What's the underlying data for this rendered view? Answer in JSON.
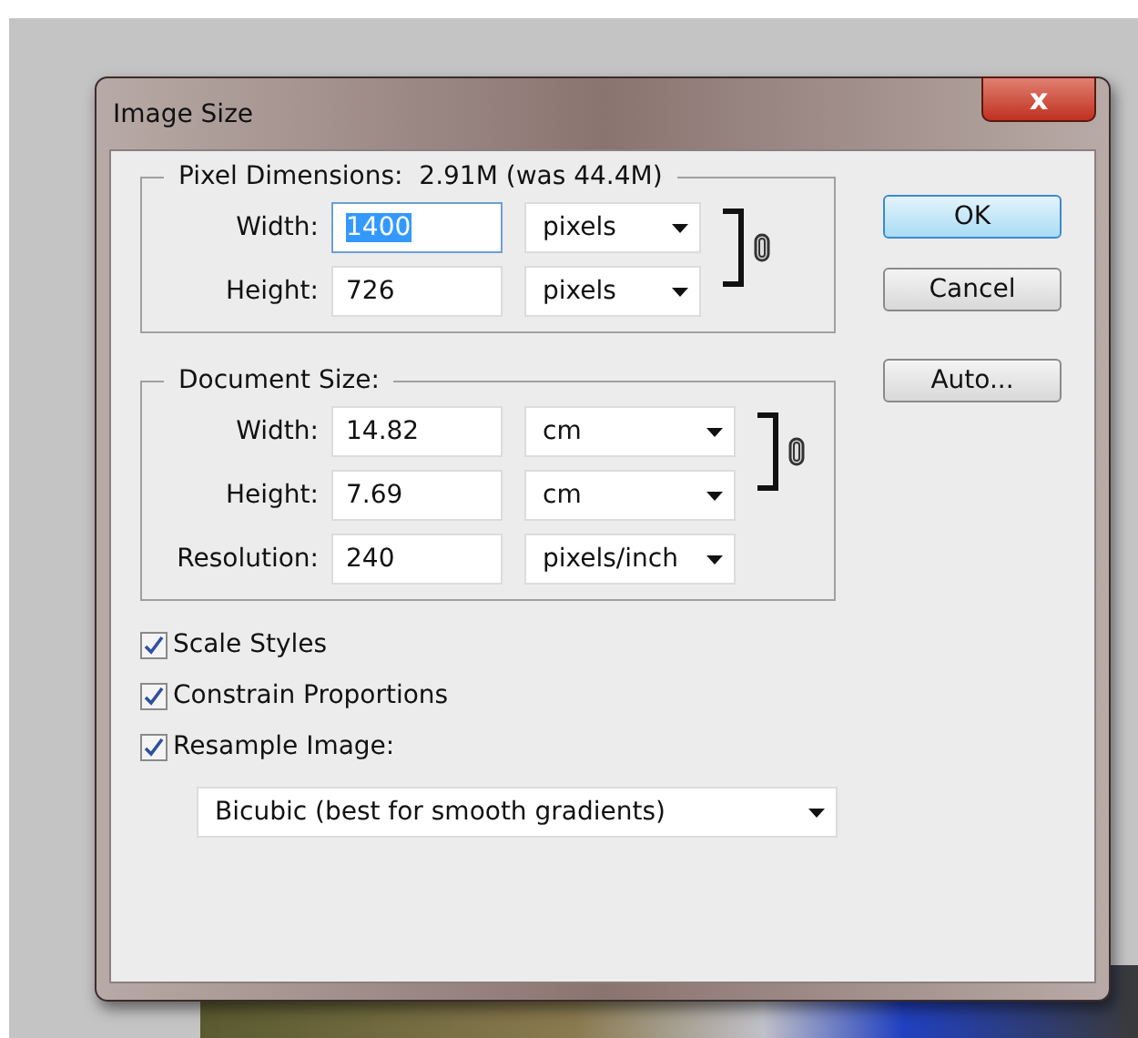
{
  "window": {
    "title": "Image Size",
    "close": "x"
  },
  "pixel_dimensions": {
    "title": "Pixel Dimensions:",
    "summary": "2.91M (was 44.4M)",
    "linked": true,
    "fields": [
      {
        "label": "Width:",
        "value": "1400",
        "focused": true,
        "unit": "pixels"
      },
      {
        "label": "Height:",
        "value": "726",
        "focused": false,
        "unit": "pixels"
      }
    ]
  },
  "document_size": {
    "title": "Document Size:",
    "linked": true,
    "fields": [
      {
        "label": "Width:",
        "value": "14.82",
        "focused": false,
        "unit": "cm"
      },
      {
        "label": "Height:",
        "value": "7.69",
        "focused": false,
        "unit": "cm"
      },
      {
        "label": "Resolution:",
        "value": "240",
        "focused": false,
        "unit": "pixels/inch"
      }
    ]
  },
  "buttons": [
    {
      "label": "OK",
      "default": true
    },
    {
      "label": "Cancel",
      "default": false
    },
    {
      "label": "Auto...",
      "default": false
    }
  ],
  "options": [
    {
      "label": "Scale Styles",
      "checked": true
    },
    {
      "label": "Constrain Proportions",
      "checked": true
    },
    {
      "label": "Resample Image:",
      "checked": true
    }
  ],
  "resample_method": "Bicubic (best for smooth gradients)"
}
